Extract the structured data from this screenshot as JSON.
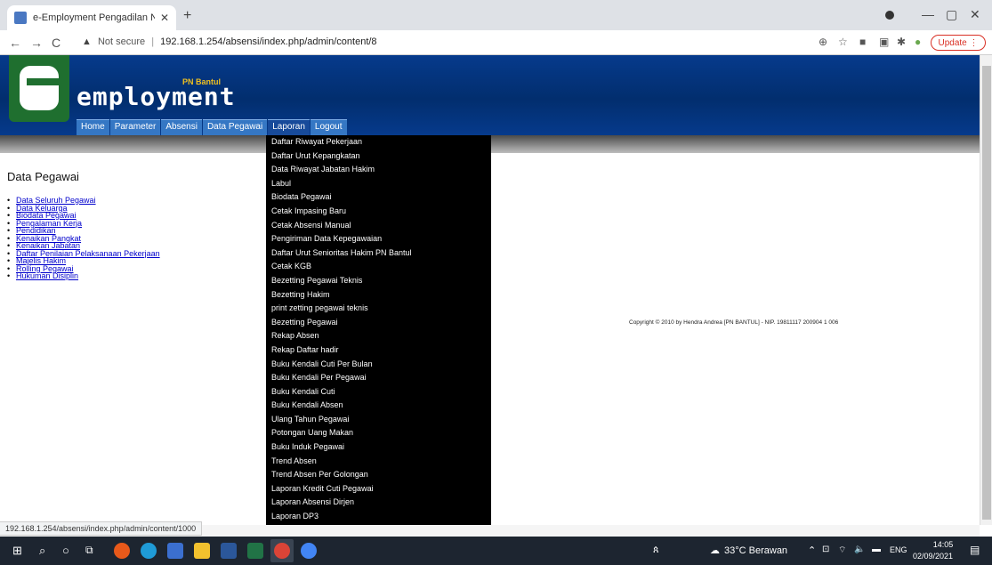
{
  "browser": {
    "tab_title": "e-Employment Pengadilan Negeri",
    "url_warning": "Not secure",
    "url_separator": "|",
    "url": "192.168.1.254/absensi/index.php/admin/content/8",
    "update_label": "Update",
    "status_url": "192.168.1.254/absensi/index.php/admin/content/1000"
  },
  "header": {
    "brand": "employment",
    "brand_sub": "PN Bantul"
  },
  "menu": [
    "Home",
    "Parameter",
    "Absensi",
    "Data Pegawai",
    "Laporan",
    "Logout"
  ],
  "sidebar": {
    "title": "Data Pegawai",
    "items": [
      "Data Seluruh Pegawai",
      "Data Keluarga",
      "Biodata Pegawai",
      "Pengalaman Kerja",
      "Pendidikan",
      "Kenaikan Pangkat",
      "Kenaikan Jabatan",
      "Daftar Penilaian Pelaksanaan Pekerjaan",
      "Majelis Hakim",
      "Rolling Pegawai",
      "Hukuman Disiplin"
    ]
  },
  "dropdown": [
    "Daftar Riwayat Pekerjaan",
    "Daftar Urut Kepangkatan",
    "Data Riwayat Jabatan Hakim",
    "Labul",
    "Biodata Pegawai",
    "Cetak Impasing Baru",
    "Cetak Absensi Manual",
    "Pengiriman Data Kepegawaian",
    "Daftar Urut Senioritas Hakim PN Bantul",
    "Cetak KGB",
    "Bezetting Pegawai Teknis",
    "Bezetting Hakim",
    "print zetting pegawai teknis",
    "Bezetting Pegawai",
    "Rekap Absen",
    "Rekap Daftar hadir",
    "Buku Kendali Cuti Per Bulan",
    "Buku Kendali Per Pegawai",
    "Buku Kendali Cuti",
    "Buku Kendali Absen",
    "Ulang Tahun Pegawai",
    "Potongan Uang Makan",
    "Buku Induk Pegawai",
    "Trend Absen",
    "Trend Absen Per Golongan",
    "Laporan Kredit Cuti Pegawai",
    "Laporan Absensi Dirjen",
    "Laporan DP3"
  ],
  "footer": {
    "copyright": "Copyright © 2010 by Hendra Andrea [PN BANTUL] - NIP. 19811117 200904 1 006"
  },
  "taskbar": {
    "weather": "33°C Berawan",
    "lang": "ENG",
    "time": "14:05",
    "date": "02/09/2021"
  },
  "colors": {
    "header_blue": "#063a8c",
    "menu_blue": "#3577c4",
    "dropdown_bg": "#000000",
    "link": "#0000cc"
  }
}
